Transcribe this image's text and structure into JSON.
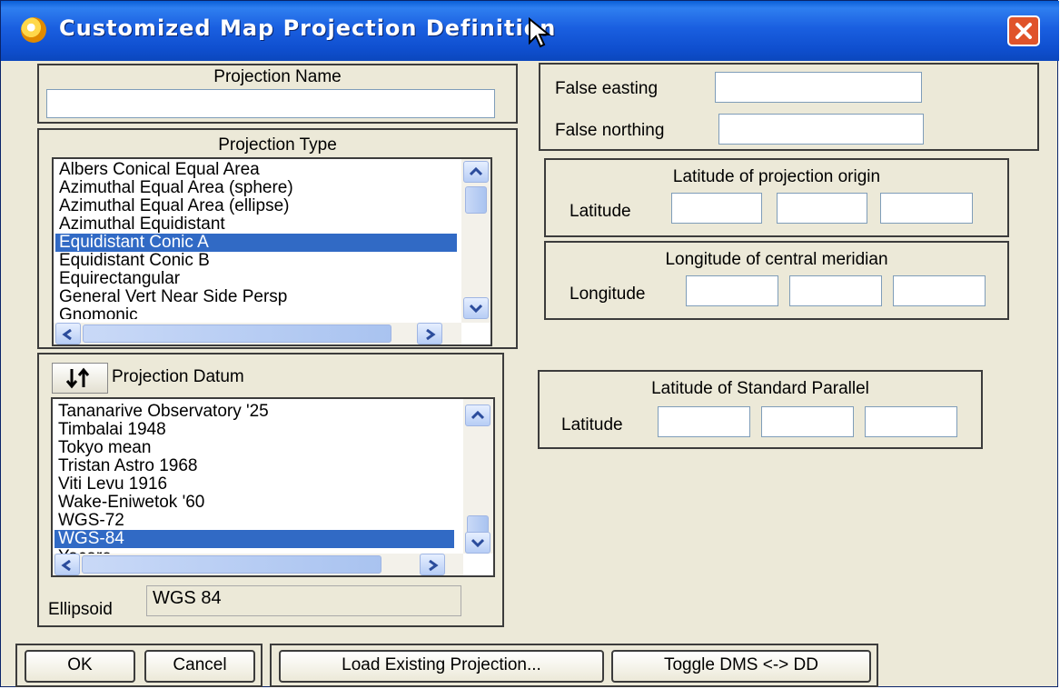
{
  "window": {
    "title": "Customized Map Projection Definition"
  },
  "projection_name": {
    "label": "Projection Name",
    "value": ""
  },
  "false_coords": {
    "easting_label": "False easting",
    "easting_value": "",
    "northing_label": "False northing",
    "northing_value": ""
  },
  "projection_type": {
    "label": "Projection Type",
    "items": [
      "Albers Conical Equal Area",
      "Azimuthal Equal Area (sphere)",
      "Azimuthal Equal Area (ellipse)",
      "Azimuthal Equidistant",
      "Equidistant Conic A",
      "Equidistant Conic B",
      "Equirectangular",
      "General Vert Near Side Persp",
      "Gnomonic"
    ],
    "selected": "Equidistant Conic A"
  },
  "latitude_origin": {
    "title": "Latitude of projection origin",
    "label": "Latitude"
  },
  "longitude_meridian": {
    "title": "Longitude of central meridian",
    "label": "Longitude"
  },
  "standard_parallel": {
    "title": "Latitude of Standard Parallel",
    "label": "Latitude"
  },
  "projection_datum": {
    "label": "Projection Datum",
    "items": [
      "Tananarive Observatory '25",
      "Timbalai 1948",
      "Tokyo mean",
      "Tristan Astro 1968",
      "Viti Levu 1916",
      "Wake-Eniwetok '60",
      "WGS-72",
      "WGS-84",
      "Yacare"
    ],
    "selected": "WGS-84",
    "sort_icon": "sort-arrows-icon"
  },
  "ellipsoid": {
    "label": "Ellipsoid",
    "value": "WGS 84"
  },
  "buttons": {
    "ok": "OK",
    "cancel": "Cancel",
    "load": "Load Existing Projection...",
    "toggle": "Toggle DMS <-> DD"
  },
  "colors": {
    "titlebar": "#0f4fcf",
    "selection": "#316ac5",
    "close": "#e0532a",
    "dialog_bg": "#ece9d8"
  }
}
